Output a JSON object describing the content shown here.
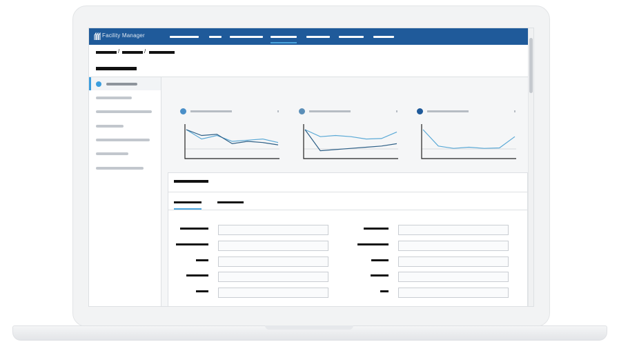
{
  "header": {
    "app_title": "Facility Manager",
    "logo_icon": "building-icon",
    "colors": {
      "topbar": "#1f5a9a",
      "accent": "#4aa4dd"
    }
  },
  "sidebar": {
    "active_icon": "circle-status-icon"
  },
  "cards": [
    {
      "dot_color": "#4a8fc8",
      "series": [
        [
          0,
          0.4,
          0.25,
          0.5,
          0.45,
          0.4,
          0.55
        ],
        [
          0,
          0.25,
          0.2,
          0.6,
          0.5,
          0.55,
          0.65
        ]
      ]
    },
    {
      "dot_color": "#5b8fb8",
      "series": [
        [
          0,
          0.3,
          0.25,
          0.3,
          0.4,
          0.38,
          0.1
        ],
        [
          0,
          0.9,
          0.85,
          0.8,
          0.75,
          0.7,
          0.6
        ]
      ]
    },
    {
      "dot_color": "#1f5a9a",
      "series": [
        [
          0,
          0.7,
          0.8,
          0.75,
          0.8,
          0.78,
          0.3
        ]
      ]
    }
  ],
  "scrollbar": {
    "icon": "scroll-thumb"
  }
}
